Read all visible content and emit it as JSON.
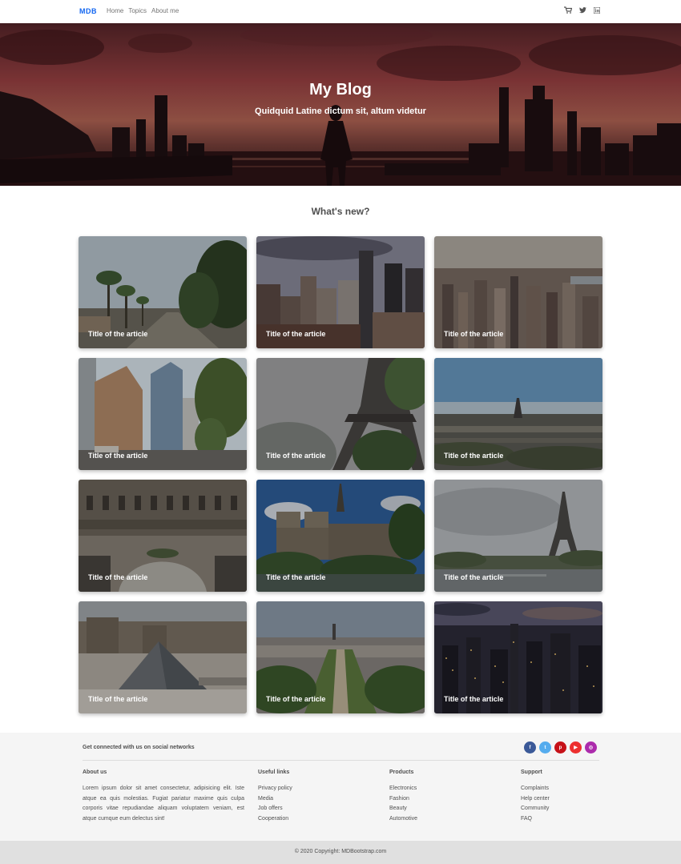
{
  "navbar": {
    "brand": "MDB",
    "links": [
      "Home",
      "Topics",
      "About me"
    ],
    "icons": [
      "cart-icon",
      "twitter-icon",
      "linkedin-icon"
    ]
  },
  "hero": {
    "title": "My Blog",
    "subtitle": "Quidquid Latine dictum sit, altum videtur"
  },
  "section": {
    "title": "What's new?"
  },
  "cards": [
    {
      "title": "Title of the article",
      "scene": "palm-street"
    },
    {
      "title": "Title of the article",
      "scene": "skyscrapers"
    },
    {
      "title": "Title of the article",
      "scene": "city-aerial"
    },
    {
      "title": "Title of the article",
      "scene": "glass-buildings"
    },
    {
      "title": "Title of the article",
      "scene": "eiffel-closeup"
    },
    {
      "title": "Title of the article",
      "scene": "paris-panorama"
    },
    {
      "title": "Title of the article",
      "scene": "courtyard"
    },
    {
      "title": "Title of the article",
      "scene": "notre-dame"
    },
    {
      "title": "Title of the article",
      "scene": "eiffel-river"
    },
    {
      "title": "Title of the article",
      "scene": "louvre-pyramid"
    },
    {
      "title": "Title of the article",
      "scene": "champ-de-mars"
    },
    {
      "title": "Title of the article",
      "scene": "night-city"
    }
  ],
  "footer": {
    "social_text": "Get connected with us on social networks",
    "social": [
      {
        "name": "facebook-icon",
        "glyph": "f",
        "color": "#3b5998"
      },
      {
        "name": "twitter-icon",
        "glyph": "t",
        "color": "#55acee"
      },
      {
        "name": "pinterest-icon",
        "glyph": "p",
        "color": "#c61118"
      },
      {
        "name": "youtube-icon",
        "glyph": "▶",
        "color": "#ed302f"
      },
      {
        "name": "instagram-icon",
        "glyph": "◎",
        "color": "#ac2bac"
      }
    ],
    "about": {
      "heading": "About us",
      "text": "Lorem ipsum dolor sit amet consectetur, adipisicing elit. Iste atque ea quis molestias. Fugiat pariatur maxime quis culpa corporis vitae repudiandae aliquam voluptatem veniam, est atque cumque eum delectus sint!"
    },
    "useful_links": {
      "heading": "Useful links",
      "items": [
        "Privacy policy",
        "Media",
        "Job offers",
        "Cooperation"
      ]
    },
    "products": {
      "heading": "Products",
      "items": [
        "Electronics",
        "Fashion",
        "Beauty",
        "Automotive"
      ]
    },
    "support": {
      "heading": "Support",
      "items": [
        "Complaints",
        "Help center",
        "Community",
        "FAQ"
      ]
    }
  },
  "copyright": {
    "prefix": "© 2020 Copyright:",
    "link": "MDBootstrap.com"
  },
  "colors": {
    "brand": "#1266f1",
    "footer_bg": "#f5f5f5",
    "copyright_bg": "#e0e0e0"
  }
}
